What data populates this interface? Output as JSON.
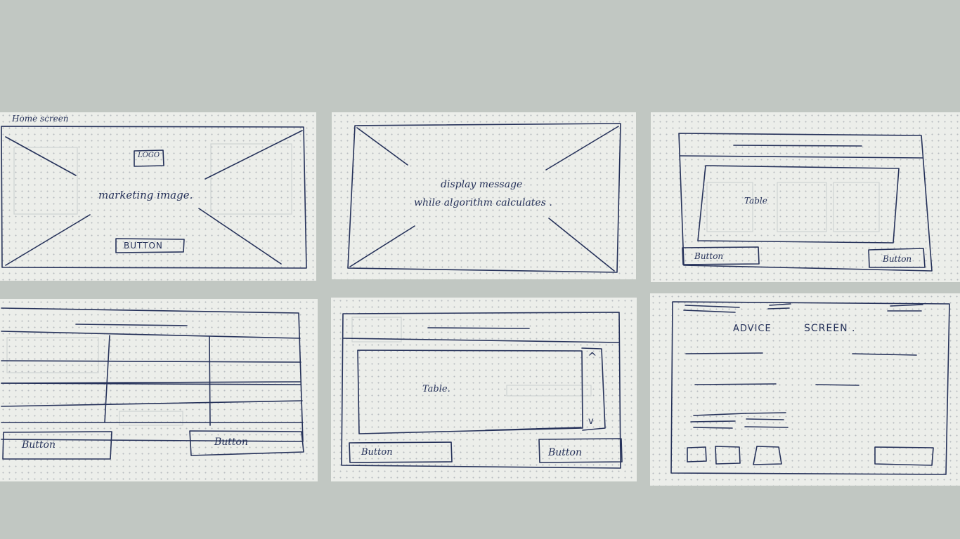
{
  "colors": {
    "background": "#c1c7c2",
    "paper": "#eceeea",
    "ink": "#26325a"
  },
  "sketches": {
    "home": {
      "title": "Home screen",
      "logo": "LOGO",
      "marketing": "marketing image.",
      "button": "BUTTON"
    },
    "loading": {
      "line1": "display message",
      "line2": "while algorithm calculates ."
    },
    "table_screen": {
      "table": "Table",
      "left_button": "Button",
      "right_button": "Button"
    },
    "grid_screen": {
      "left_button": "Button",
      "right_button": "Button"
    },
    "scroll_table_screen": {
      "table": "Table.",
      "up_arrow": "^",
      "down_arrow": "v",
      "left_button": "Button",
      "right_button": "Button"
    },
    "advice": {
      "word1": "ADVICE",
      "word2": "SCREEN ."
    }
  }
}
